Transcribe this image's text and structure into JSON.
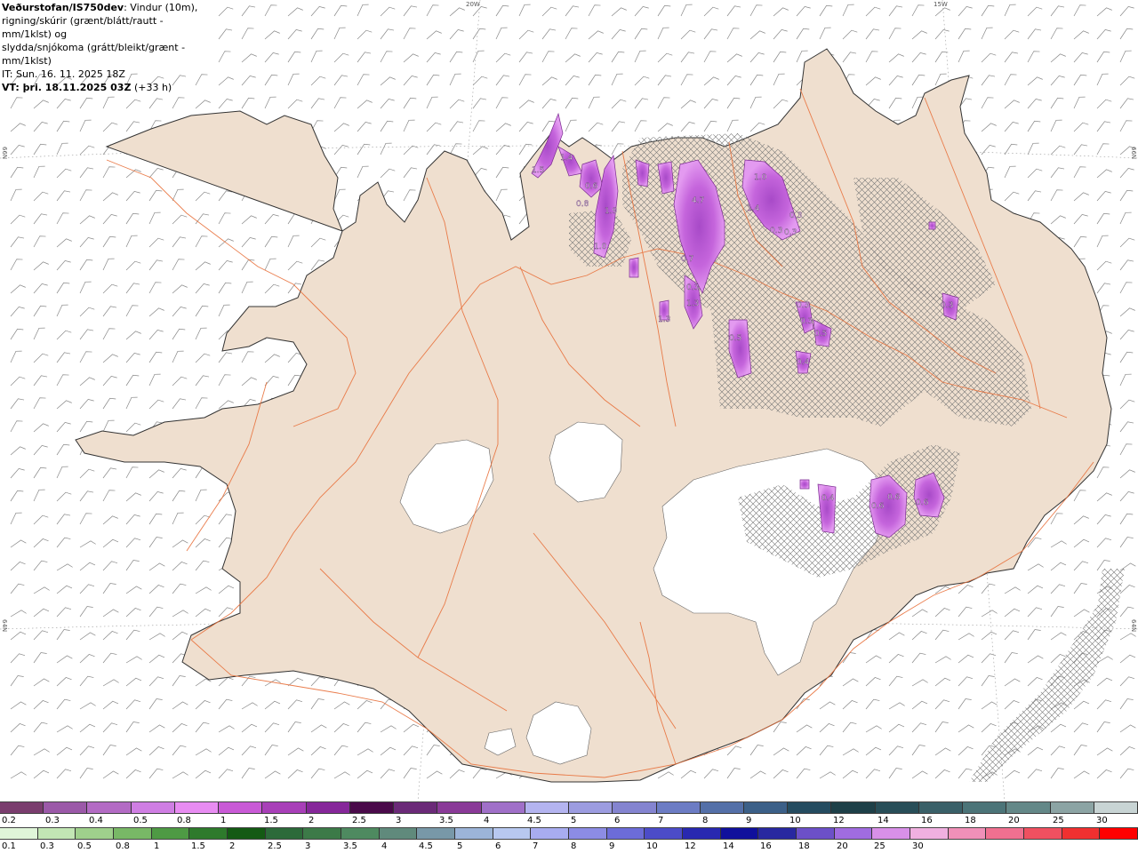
{
  "header": {
    "title": "Veðurstofan/IS750dev",
    "description_line1": ": Vindur (10m),",
    "description_line2": "rigning/skúrir (grænt/blátt/rautt - mm/1klst) og",
    "description_line3": "slydda/snjókoma (grátt/bleikt/grænt - mm/1klst)",
    "it_label": "IT: Sun. 16. 11. 2025 18Z",
    "vt_label": "VT: þri. 18.11.2025 03Z",
    "vt_offset": "(+33 h)"
  },
  "coords": {
    "lon20": "20W",
    "lon15": "15W",
    "lat66_left": "66N",
    "lat66_right": "66N",
    "lat64_left": "64N",
    "lat64_right": "64N"
  },
  "precip_labels": [
    "1.5",
    "1.4",
    "0.6",
    "0.8",
    "1.9",
    "1.0",
    "4.7",
    "1.0",
    "1.4",
    "0.3",
    "0.3",
    "0.3",
    "0.7",
    "0.3",
    "1.3",
    "1.3",
    "0.5",
    "0.3",
    "0.3",
    "0.5",
    "0.4",
    "0.3",
    "0.4",
    "0.6",
    "0.6",
    "0.6"
  ],
  "legend_snow": {
    "labels": [
      "0.2",
      "0.3",
      "0.4",
      "0.5",
      "0.8",
      "1",
      "1.5",
      "2",
      "2.5",
      "3",
      "3.5",
      "4",
      "4.5",
      "5",
      "6",
      "7",
      "8",
      "9",
      "10",
      "12",
      "14",
      "16",
      "18",
      "20",
      "25",
      "30"
    ],
    "colors": [
      "#7a3d6e",
      "#9b59a8",
      "#b36bc4",
      "#cf7ee3",
      "#e88cf2",
      "#c95ad6",
      "#a83fb8",
      "#86279a",
      "#4a0a4a",
      "#6b2a78",
      "#8a3a98",
      "#a070c8",
      "#b4b4f0",
      "#9c9ce0",
      "#8484d0",
      "#6c7cc4",
      "#5470a8",
      "#3c6088",
      "#254c60",
      "#1e4048",
      "#284e58",
      "#3a6068",
      "#4c7478",
      "#648888",
      "#8ca4a4",
      "#c8d4d4"
    ]
  },
  "legend_rain": {
    "labels": [
      "0.1",
      "0.3",
      "0.5",
      "0.8",
      "1",
      "1.5",
      "2",
      "2.5",
      "3",
      "3.5",
      "4",
      "4.5",
      "5",
      "6",
      "7",
      "8",
      "9",
      "10",
      "12",
      "14",
      "16",
      "18",
      "20",
      "25",
      "30"
    ],
    "colors": [
      "#dff5d8",
      "#c2e6b4",
      "#9fd08c",
      "#78b866",
      "#4e9a44",
      "#2e7a2c",
      "#145a14",
      "#2c6a3a",
      "#3c7a48",
      "#4e8a60",
      "#608a7c",
      "#7898a8",
      "#9cb4d8",
      "#b8c8f0",
      "#a8acf0",
      "#8c8ce4",
      "#6c6cd8",
      "#4c4cc8",
      "#2828b0",
      "#10109c",
      "#2828a0",
      "#6c50c8",
      "#a06ce0",
      "#d890e8",
      "#f0b0e0",
      "#f090b8",
      "#f07090",
      "#f05060",
      "#f03030",
      "#ff0000"
    ]
  }
}
